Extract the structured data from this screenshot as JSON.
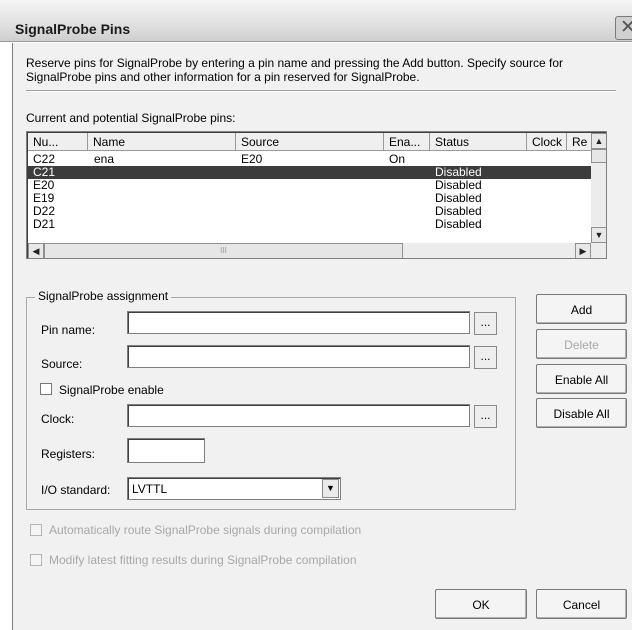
{
  "window": {
    "title": "SignalProbe Pins",
    "close_glyph": "✕"
  },
  "description": "Reserve pins for SignalProbe by entering a pin name and pressing the Add button. Specify source for SignalProbe pins and other information for a pin reserved for SignalProbe.",
  "list": {
    "label": "Current and potential SignalProbe pins:",
    "columns": [
      "Nu...",
      "Name",
      "Source",
      "Ena...",
      "Status",
      "Clock",
      "Re"
    ],
    "rows": [
      {
        "number": "C22",
        "name": "ena",
        "source": "E20",
        "enabled": "On",
        "status": "",
        "clock": ""
      },
      {
        "number": "C21",
        "name": "",
        "source": "",
        "enabled": "",
        "status": "Disabled",
        "clock": ""
      },
      {
        "number": "E20",
        "name": "",
        "source": "",
        "enabled": "",
        "status": "Disabled",
        "clock": ""
      },
      {
        "number": "E19",
        "name": "",
        "source": "",
        "enabled": "",
        "status": "Disabled",
        "clock": ""
      },
      {
        "number": "D22",
        "name": "",
        "source": "",
        "enabled": "",
        "status": "Disabled",
        "clock": ""
      },
      {
        "number": "D21",
        "name": "",
        "source": "",
        "enabled": "",
        "status": "Disabled",
        "clock": ""
      }
    ],
    "selected_index": 1,
    "scroll_glyphs": {
      "up": "▲",
      "down": "▼",
      "left": "◀",
      "right": "▶",
      "grip": "III"
    }
  },
  "assignment": {
    "group_label": "SignalProbe assignment",
    "pin_name_label": "Pin name:",
    "pin_name_value": "",
    "source_label": "Source:",
    "source_value": "",
    "enable_label": "SignalProbe enable",
    "enable_checked": false,
    "clock_label": "Clock:",
    "clock_value": "",
    "registers_label": "Registers:",
    "registers_value": "",
    "io_standard_label": "I/O standard:",
    "io_standard_value": "LVTTL",
    "browse_label": "...",
    "combo_arrow": "▼"
  },
  "side_buttons": {
    "add": "Add",
    "delete": "Delete",
    "enable_all": "Enable All",
    "disable_all": "Disable All"
  },
  "options": {
    "auto_route": "Automatically route SignalProbe signals during compilation",
    "modify_fitting": "Modify latest fitting results during SignalProbe compilation"
  },
  "footer": {
    "ok": "OK",
    "cancel": "Cancel"
  }
}
